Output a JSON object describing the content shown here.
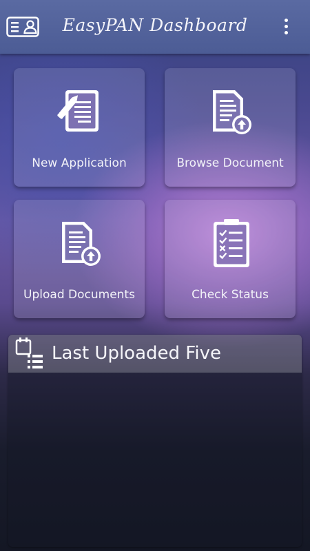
{
  "header": {
    "title": "EasyPAN Dashboard",
    "left_icon": "id-card-icon",
    "menu_icon": "more-vertical-icon"
  },
  "tiles": [
    {
      "label": "New Application",
      "icon": "new-document-pencil-icon"
    },
    {
      "label": "Browse Document",
      "icon": "document-upload-icon"
    },
    {
      "label": "Upload Documents",
      "icon": "document-upload-icon"
    },
    {
      "label": "Check Status",
      "icon": "clipboard-checklist-icon"
    }
  ],
  "panel": {
    "title": "Last Uploaded Five",
    "icon": "calendar-list-icon"
  },
  "colors": {
    "appbar": "#5163a0",
    "text": "#ffffff"
  }
}
